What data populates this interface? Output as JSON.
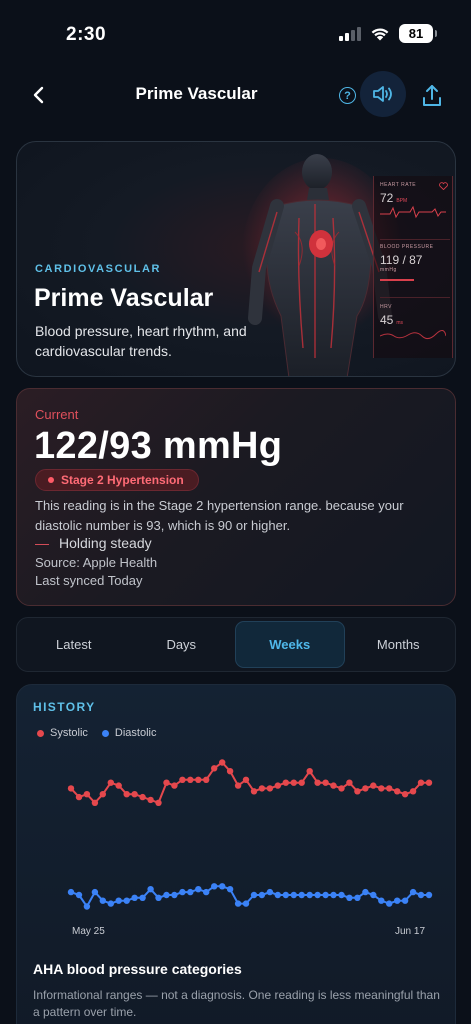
{
  "status": {
    "time": "2:30",
    "battery": "81"
  },
  "nav": {
    "title": "Prime Vascular",
    "help_glyph": "?"
  },
  "hero": {
    "eyebrow": "CARDIOVASCULAR",
    "title": "Prime Vascular",
    "description": "Blood pressure, heart rhythm, and cardiovascular trends.",
    "panel": [
      {
        "label": "HEART RATE",
        "value": "72",
        "unit": "BPM"
      },
      {
        "label": "BLOOD PRESSURE",
        "value": "119 / 87",
        "unit": "mmHg"
      },
      {
        "label": "HRV",
        "value": "45",
        "unit": "ms"
      }
    ]
  },
  "current": {
    "label": "Current",
    "value": "122/93 mmHg",
    "badge": "Stage 2 Hypertension",
    "description": "This reading is in the Stage 2 hypertension range. because your diastolic number is 93, which is 90 or higher.",
    "trend_dash": "—",
    "trend": "Holding steady",
    "source": "Source: Apple Health",
    "synced": "Last synced Today"
  },
  "segments": [
    {
      "label": "Latest",
      "active": false
    },
    {
      "label": "Days",
      "active": false
    },
    {
      "label": "Weeks",
      "active": true
    },
    {
      "label": "Months",
      "active": false
    }
  ],
  "history": {
    "title": "HISTORY",
    "aha_title": "AHA blood pressure categories",
    "aha_desc": "Informational ranges — not a diagnosis. One reading is less meaningful than a pattern over time."
  },
  "chart_data": {
    "type": "line",
    "x_start_label": "May 25",
    "x_end_label": "Jun 17",
    "series": [
      {
        "name": "Systolic",
        "color": "#e5484d",
        "values": [
          123,
          120,
          121,
          118,
          121,
          125,
          124,
          121,
          121,
          120,
          119,
          118,
          125,
          124,
          126,
          126,
          126,
          126,
          130,
          132,
          129,
          124,
          126,
          122,
          123,
          123,
          124,
          125,
          125,
          125,
          129,
          125,
          125,
          124,
          123,
          125,
          122,
          123,
          124,
          123,
          123,
          122,
          121,
          122,
          125,
          125
        ]
      },
      {
        "name": "Diastolic",
        "color": "#3b82f6",
        "values": [
          87,
          86,
          82,
          87,
          84,
          83,
          84,
          84,
          85,
          85,
          88,
          85,
          86,
          86,
          87,
          87,
          88,
          87,
          89,
          89,
          88,
          83,
          83,
          86,
          86,
          87,
          86,
          86,
          86,
          86,
          86,
          86,
          86,
          86,
          86,
          85,
          85,
          87,
          86,
          84,
          83,
          84,
          84,
          87,
          86,
          86
        ]
      }
    ],
    "ylim": [
      78,
      136
    ],
    "legend": "top-left",
    "grid": false
  }
}
